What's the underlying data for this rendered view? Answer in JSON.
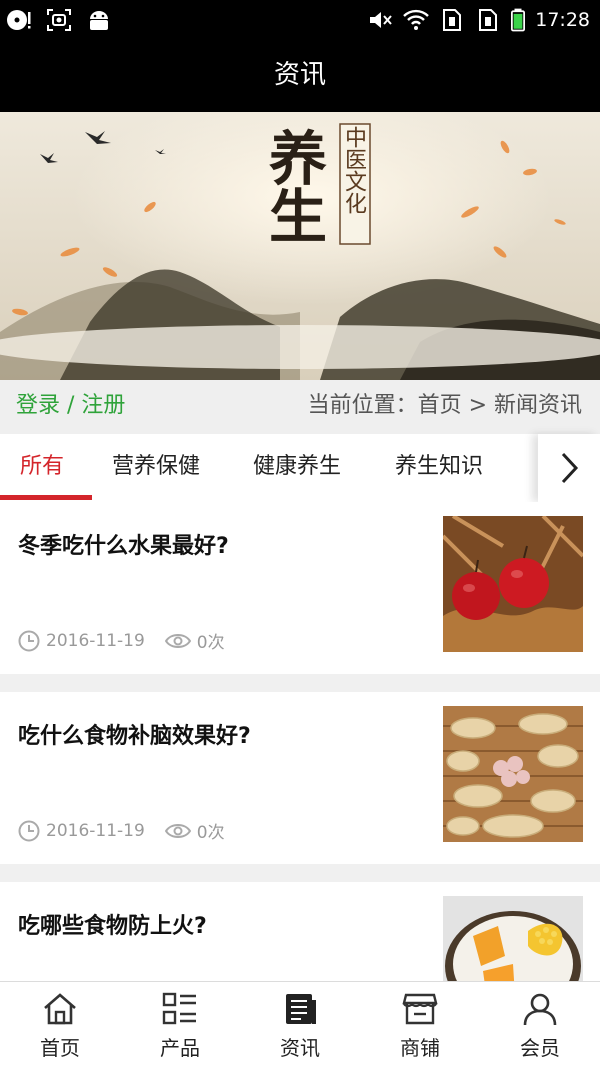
{
  "status_bar": {
    "time": "17:28",
    "icons": [
      "cd-icon",
      "screenshot-icon",
      "android-icon",
      "mute-icon",
      "wifi-icon",
      "sim1-icon",
      "sim2-icon",
      "battery-icon"
    ]
  },
  "header": {
    "title": "资讯"
  },
  "banner": {
    "calligraphy": "养生",
    "seal": "中医文化"
  },
  "breadcrumb": {
    "login_label": "登录 / 注册",
    "location_label": "当前位置：首页 > 新闻资讯"
  },
  "tabs": [
    {
      "label": "所有",
      "active": true
    },
    {
      "label": "营养保健",
      "active": false
    },
    {
      "label": "健康养生",
      "active": false
    },
    {
      "label": "养生知识",
      "active": false
    }
  ],
  "articles": [
    {
      "title": "冬季吃什么水果最好?",
      "date": "2016-11-19",
      "views": "0次",
      "thumb": "red-apples-image"
    },
    {
      "title": "吃什么食物补脑效果好?",
      "date": "2016-11-19",
      "views": "0次",
      "thumb": "peanuts-image"
    },
    {
      "title": "吃哪些食物防上火?",
      "date": "",
      "views": "",
      "thumb": "corn-pumpkin-image"
    }
  ],
  "bottom_nav": [
    {
      "label": "首页",
      "icon": "home-icon"
    },
    {
      "label": "产品",
      "icon": "grid-list-icon"
    },
    {
      "label": "资讯",
      "icon": "news-icon"
    },
    {
      "label": "商铺",
      "icon": "shop-icon"
    },
    {
      "label": "会员",
      "icon": "user-icon"
    }
  ],
  "colors": {
    "accent": "#d4252b",
    "login_green": "#2fa33a",
    "bar_black": "#000000"
  }
}
